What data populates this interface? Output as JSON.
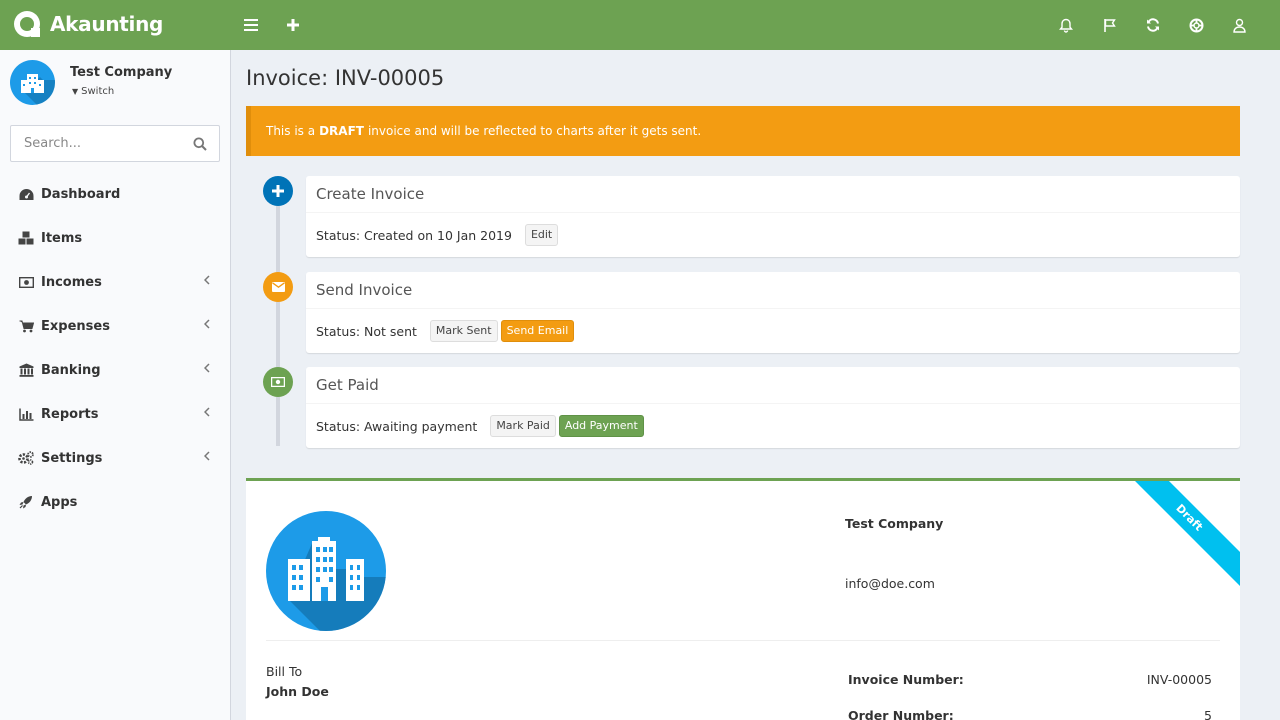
{
  "app": {
    "name": "Akaunting"
  },
  "company": {
    "name": "Test Company",
    "switch_label": "Switch"
  },
  "search": {
    "placeholder": "Search..."
  },
  "menu": [
    {
      "label": "Dashboard",
      "icon": "dashboard-icon",
      "has_submenu": false
    },
    {
      "label": "Items",
      "icon": "cubes-icon",
      "has_submenu": false
    },
    {
      "label": "Incomes",
      "icon": "money-icon",
      "has_submenu": true
    },
    {
      "label": "Expenses",
      "icon": "cart-icon",
      "has_submenu": true
    },
    {
      "label": "Banking",
      "icon": "bank-icon",
      "has_submenu": true
    },
    {
      "label": "Reports",
      "icon": "bar-chart-icon",
      "has_submenu": true
    },
    {
      "label": "Settings",
      "icon": "gears-icon",
      "has_submenu": true
    },
    {
      "label": "Apps",
      "icon": "rocket-icon",
      "has_submenu": false
    }
  ],
  "page": {
    "title": "Invoice: INV-00005"
  },
  "alert": {
    "prefix": "This is a",
    "strong": "DRAFT",
    "suffix": "invoice and will be reflected to charts after it gets sent."
  },
  "steps": [
    {
      "title": "Create Invoice",
      "status": "Status: Created on 10 Jan 2019",
      "buttons": [
        "Edit"
      ],
      "icon": "plus-icon",
      "color": "#0073b7"
    },
    {
      "title": "Send Invoice",
      "status": "Status: Not sent",
      "buttons": [
        "Mark Sent",
        "Send Email"
      ],
      "icon": "envelope-icon",
      "color": "#f39c12"
    },
    {
      "title": "Get Paid",
      "status": "Status: Awaiting payment",
      "buttons": [
        "Mark Paid",
        "Add Payment"
      ],
      "icon": "money-icon",
      "color": "#6da252"
    }
  ],
  "invoice": {
    "company_name": "Test Company",
    "company_email": "info@doe.com",
    "ribbon": "Draft",
    "bill_to_label": "Bill To",
    "customer_name": "John Doe",
    "invoice_number_label": "Invoice Number:",
    "invoice_number": "INV-00005",
    "order_number_label": "Order Number:",
    "order_number": "5"
  },
  "colors": {
    "brand": "#6da252",
    "warning": "#f39c12",
    "primary": "#0073b7",
    "info": "#00c0ef"
  }
}
